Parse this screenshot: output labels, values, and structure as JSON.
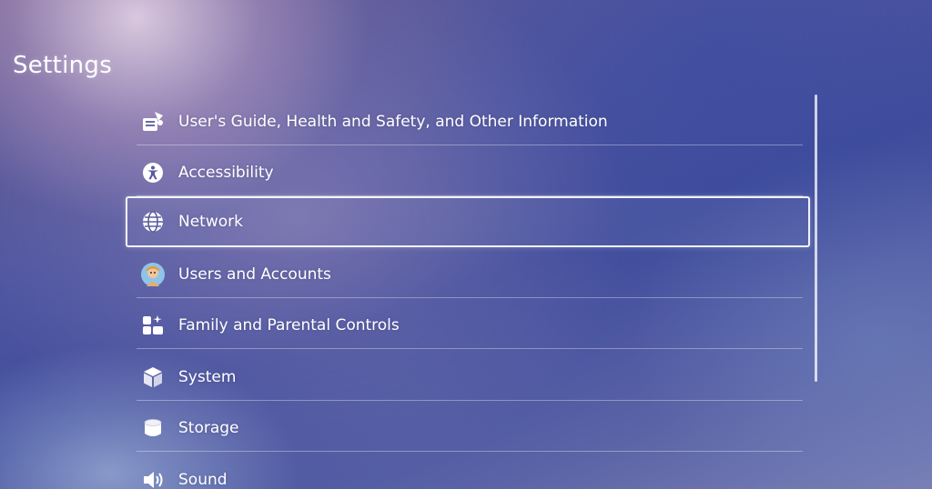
{
  "page": {
    "title": "Settings"
  },
  "settings": {
    "items": [
      {
        "label": "User's Guide, Health and Safety, and Other Information",
        "icon": "users-guide-icon",
        "selected": false
      },
      {
        "label": "Accessibility",
        "icon": "accessibility-icon",
        "selected": false
      },
      {
        "label": "Network",
        "icon": "network-globe-icon",
        "selected": true
      },
      {
        "label": "Users and Accounts",
        "icon": "user-avatar-icon",
        "selected": false
      },
      {
        "label": "Family and Parental Controls",
        "icon": "family-controls-icon",
        "selected": false
      },
      {
        "label": "System",
        "icon": "system-cube-icon",
        "selected": false
      },
      {
        "label": "Storage",
        "icon": "storage-cylinder-icon",
        "selected": false
      },
      {
        "label": "Sound",
        "icon": "speaker-icon",
        "selected": false
      }
    ]
  },
  "colors": {
    "text": "#ffffff",
    "selection_border": "#ffffff",
    "background_primary": "#4d55a0"
  }
}
